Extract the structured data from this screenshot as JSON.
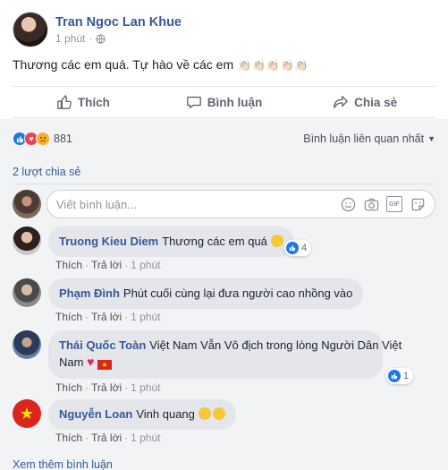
{
  "post": {
    "author": "Tran Ngoc Lan Khue",
    "time": "1 phút",
    "text": "Thương các em quá. Tự hào về các em",
    "hand_icons": [
      "👏🏻",
      "👏🏻",
      "👏🏻",
      "👏🏻",
      "👏🏻"
    ]
  },
  "actions": {
    "like": "Thích",
    "comment": "Bình luận",
    "share": "Chia sẻ"
  },
  "reactions": {
    "count": "881",
    "sort_label": "Bình luận liên quan nhất"
  },
  "shares": "2 lượt chia sẻ",
  "composer": {
    "placeholder": "Viết bình luận..."
  },
  "comments": [
    {
      "name": "Truong Kieu Diem",
      "text": "Thương các em quá",
      "reaction_count": "4",
      "like": "Thích",
      "reply": "Trả lời",
      "time": "1 phút"
    },
    {
      "name": "Phạm Đình",
      "text": "Phút cuối cùng lại đưa người cao nhồng vào",
      "like": "Thích",
      "reply": "Trả lời",
      "time": "1 phút"
    },
    {
      "name": "Thái Quốc Toàn",
      "text_line1": "Việt Nam Vẫn Vô địch trong lòng Người Dân Việt",
      "text_line2": "Nam",
      "reaction_count": "1",
      "like": "Thích",
      "reply": "Trả lời",
      "time": "1 phút"
    },
    {
      "name": "Nguyễn Loan",
      "text": "Vinh quang",
      "like": "Thích",
      "reply": "Trả lời",
      "time": "1 phút"
    }
  ],
  "more_comments": "Xem thêm bình luận",
  "colors": {
    "link_blue": "#365899",
    "like_blue": "#1877f2",
    "bubble_gray": "#e4e6eb",
    "area_gray": "#f2f3f5"
  }
}
